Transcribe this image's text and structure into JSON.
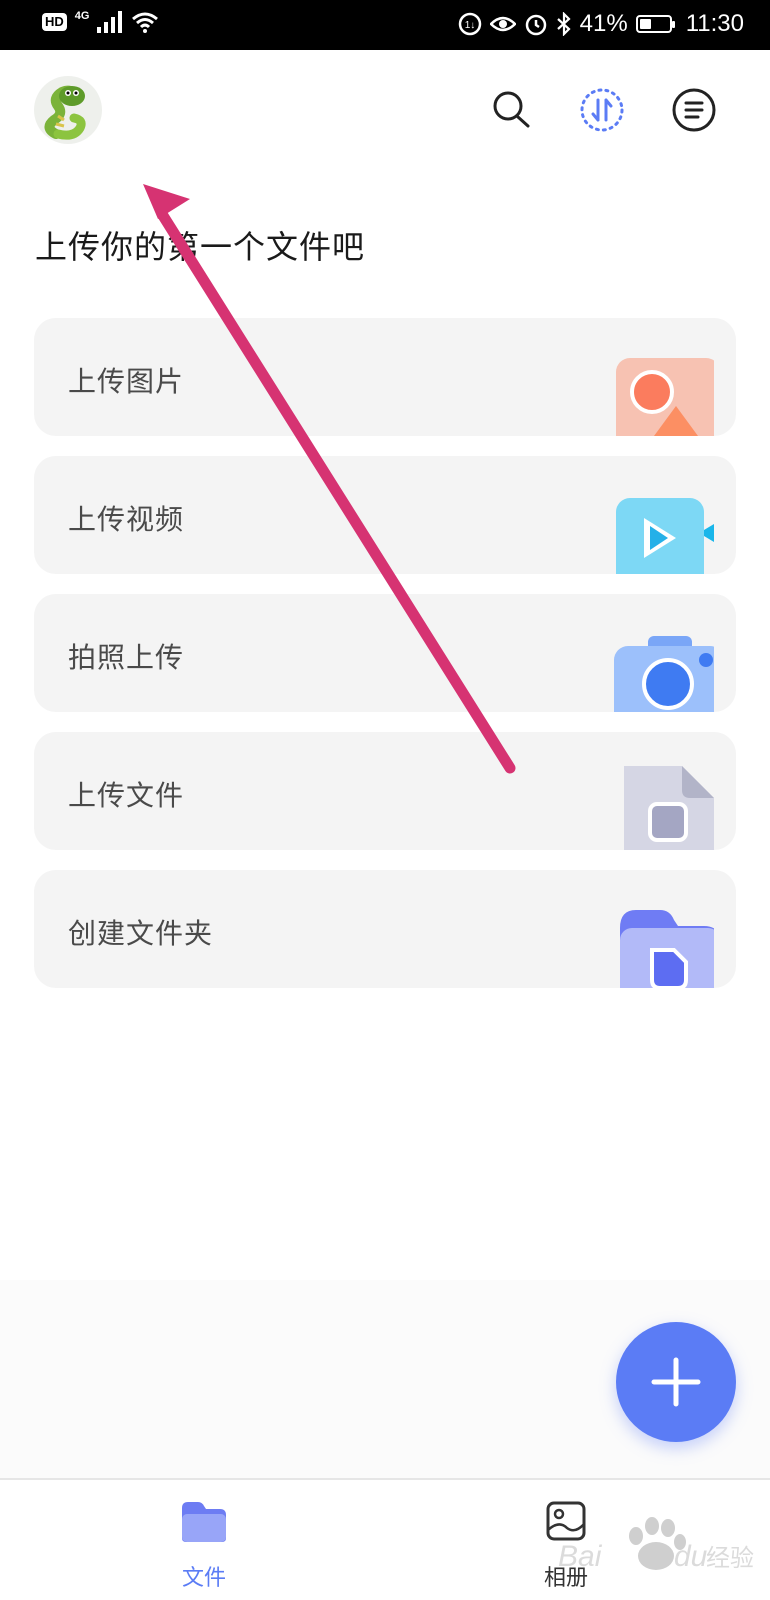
{
  "status_bar": {
    "hd": "HD",
    "network": "4G",
    "battery_text": "41%",
    "battery_level": 0.41,
    "time": "11:30"
  },
  "header": {
    "avatar_icon": "snake-avatar",
    "icons": [
      "search-icon",
      "transfer-icon",
      "menu-icon"
    ]
  },
  "page": {
    "title": "上传你的第一个文件吧"
  },
  "cards": [
    {
      "label": "上传图片",
      "icon": "image-icon"
    },
    {
      "label": "上传视频",
      "icon": "video-icon"
    },
    {
      "label": "拍照上传",
      "icon": "camera-icon"
    },
    {
      "label": "上传文件",
      "icon": "file-icon"
    },
    {
      "label": "创建文件夹",
      "icon": "folder-icon"
    }
  ],
  "fab": {
    "icon": "plus-icon"
  },
  "tabs": [
    {
      "label": "文件",
      "icon": "folder-icon",
      "active": true
    },
    {
      "label": "相册",
      "icon": "album-icon",
      "active": false
    }
  ],
  "watermark": {
    "text": "Baidu经验"
  },
  "colors": {
    "accent": "#5b7cf5",
    "card_bg": "#f4f4f4",
    "annotation_arrow": "#d63372",
    "tab_inactive": "#333333"
  }
}
